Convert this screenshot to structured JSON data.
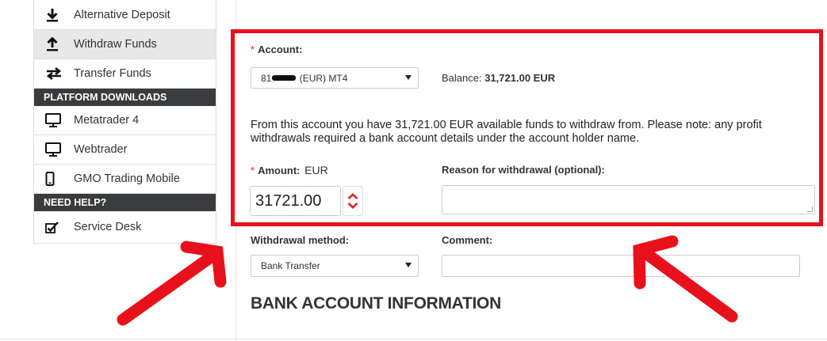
{
  "sidebar": {
    "items_top": [
      {
        "label": "Alternative Deposit",
        "icon": "download-icon"
      },
      {
        "label": "Withdraw Funds",
        "icon": "upload-icon",
        "active": true
      },
      {
        "label": "Transfer Funds",
        "icon": "transfer-icon"
      }
    ],
    "platform_heading": "PLATFORM DOWNLOADS",
    "platform_items": [
      {
        "label": "Metatrader 4",
        "icon": "monitor-icon"
      },
      {
        "label": "Webtrader",
        "icon": "monitor-icon"
      },
      {
        "label": "GMO Trading Mobile",
        "icon": "mobile-icon"
      }
    ],
    "help_heading": "NEED HELP?",
    "help_items": [
      {
        "label": "Service Desk",
        "icon": "checkbox-pen-icon"
      }
    ]
  },
  "form": {
    "required_mark": "*",
    "account_label": "Account:",
    "account_value_prefix": "81",
    "account_value_suffix": "(EUR) MT4",
    "balance_label": "Balance:",
    "balance_value": "31,721.00 EUR",
    "info_part1": "From this account you have ",
    "info_amount": "31,721.00 EUR",
    "info_part2": " available funds to withdraw from. Please note: any profit withdrawals required a bank account details under the account holder name.",
    "amount_label": "Amount:",
    "amount_currency": "EUR",
    "amount_value": "31721.00",
    "reason_label": "Reason for withdrawal (optional):",
    "method_label": "Withdrawal method:",
    "method_value": "Bank Transfer",
    "comment_label": "Comment:",
    "bank_section_title": "BANK ACCOUNT INFORMATION"
  },
  "colors": {
    "highlight": "#e8101a",
    "accent_red": "#e0242a",
    "sidebar_heading_bg": "#3a3b3d"
  }
}
